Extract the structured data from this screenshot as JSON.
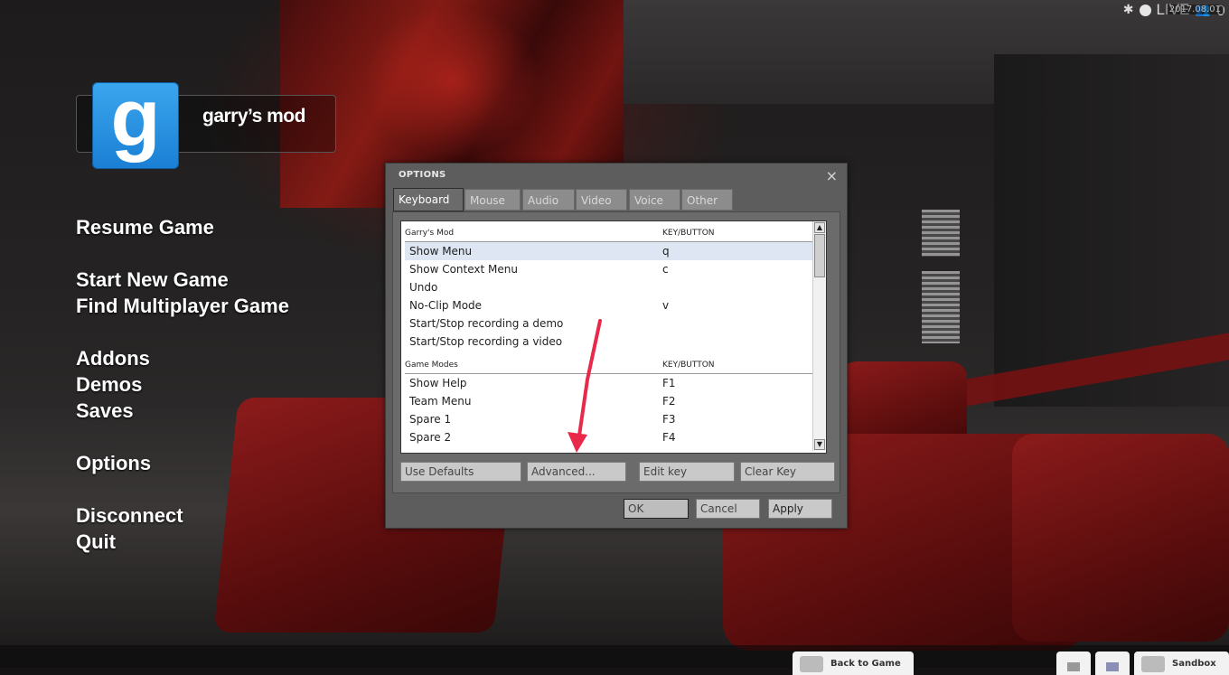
{
  "hud": {
    "live": "LIVE",
    "count": "0",
    "version": "2017.08.01"
  },
  "logo": {
    "letter": "g",
    "name": "garry’s mod"
  },
  "menu": {
    "resume": "Resume Game",
    "start_new": "Start New Game",
    "find_mp": "Find Multiplayer Game",
    "addons": "Addons",
    "demos": "Demos",
    "saves": "Saves",
    "options": "Options",
    "disconnect": "Disconnect",
    "quit": "Quit"
  },
  "options_dialog": {
    "title": "OPTIONS",
    "close": "×",
    "tabs": [
      "Keyboard",
      "Mouse",
      "Audio",
      "Video",
      "Voice",
      "Other"
    ],
    "active_tab": "Keyboard",
    "sections": [
      {
        "heading": "Garry's Mod",
        "column": "KEY/BUTTON",
        "rows": [
          {
            "action": "Show Menu",
            "key": "q",
            "selected": true
          },
          {
            "action": "Show Context Menu",
            "key": "c"
          },
          {
            "action": "Undo",
            "key": ""
          },
          {
            "action": "No-Clip Mode",
            "key": "v"
          },
          {
            "action": "Start/Stop recording a demo",
            "key": ""
          },
          {
            "action": "Start/Stop recording a video",
            "key": ""
          }
        ]
      },
      {
        "heading": "Game Modes",
        "column": "KEY/BUTTON",
        "rows": [
          {
            "action": "Show Help",
            "key": "F1"
          },
          {
            "action": "Team Menu",
            "key": "F2"
          },
          {
            "action": "Spare 1",
            "key": "F3"
          },
          {
            "action": "Spare 2",
            "key": "F4"
          }
        ]
      }
    ],
    "buttons": {
      "use_defaults": "Use Defaults",
      "advanced": "Advanced...",
      "edit_key": "Edit key",
      "clear_key": "Clear Key",
      "ok": "OK",
      "cancel": "Cancel",
      "apply": "Apply"
    }
  },
  "bottom": {
    "back_to_game": "Back to Game",
    "gamemode": "Sandbox"
  },
  "colors": {
    "accent_blue": "#1a7fd4",
    "arrow_red": "#e8294a"
  }
}
